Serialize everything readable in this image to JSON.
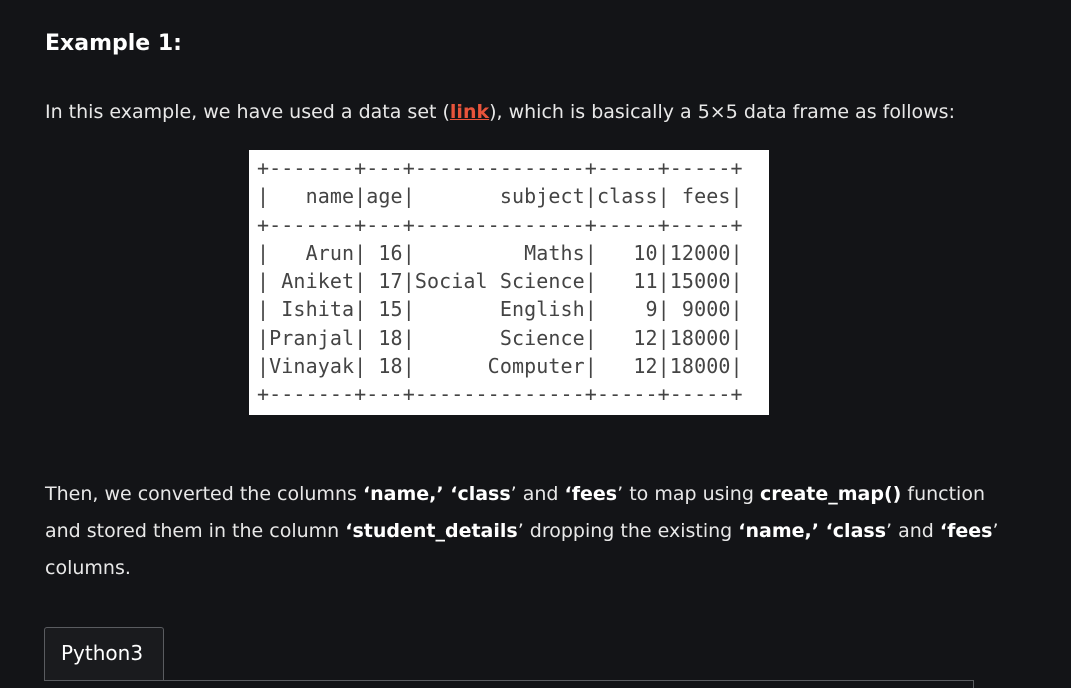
{
  "heading": "Example 1:",
  "para1": {
    "before": "In this example, we have used a data set (",
    "link": "link",
    "after": "), which is basically a 5×5 data frame as follows:"
  },
  "table_ascii": [
    "+-------+---+--------------+-----+-----+",
    "|   name|age|       subject|class| fees|",
    "+-------+---+--------------+-----+-----+",
    "|   Arun| 16|         Maths|   10|12000|",
    "| Aniket| 17|Social Science|   11|15000|",
    "| Ishita| 15|       English|    9| 9000|",
    "|Pranjal| 18|       Science|   12|18000|",
    "|Vinayak| 18|      Computer|   12|18000|",
    "+-------+---+--------------+-----+-----+"
  ],
  "para2": {
    "t1": "Then, we converted the columns ",
    "b1": "‘name,’ ‘class",
    "t2": "’ and ",
    "b2": "‘fees",
    "t3": "’ to map using ",
    "b3": "create_map()",
    "t4": " function and stored them in the column ",
    "b4": "‘student_details",
    "t5": "’ dropping the existing ",
    "b5": "‘name,’ ‘class",
    "t6": "’ and ",
    "b6": "‘fees",
    "t7": "’ columns."
  },
  "code_tab": "Python3"
}
